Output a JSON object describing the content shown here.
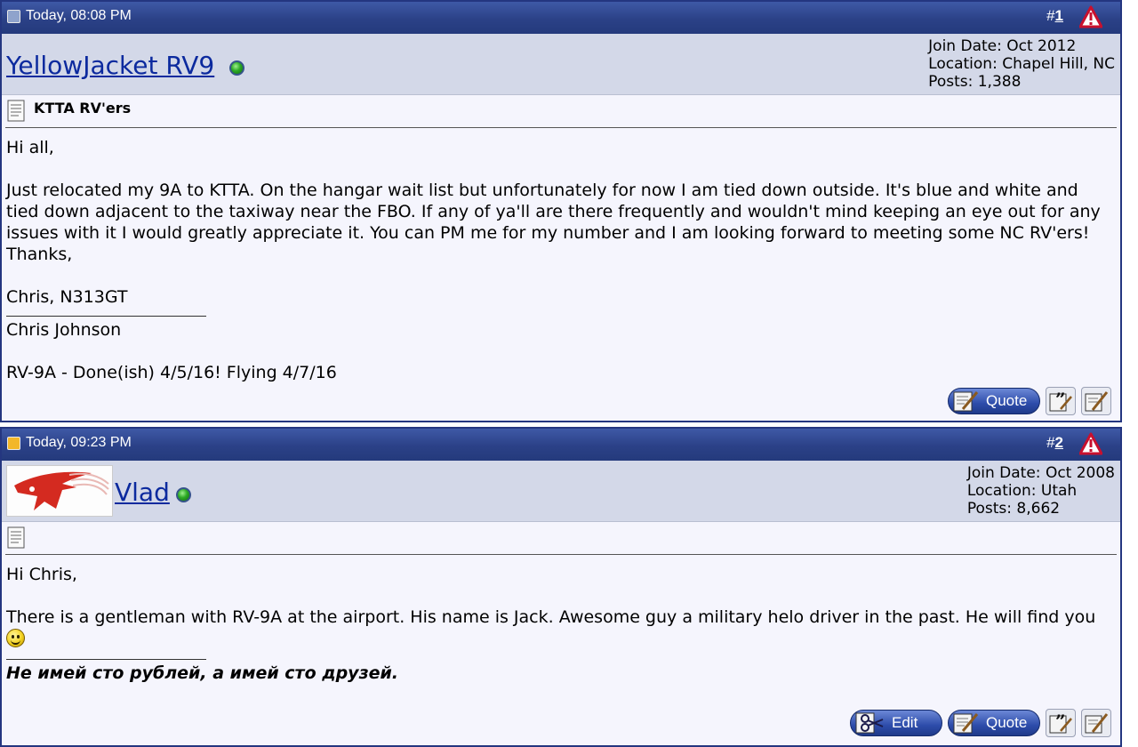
{
  "posts": [
    {
      "date": "Today, 08:08 PM",
      "number_prefix": "#",
      "number": "1",
      "username": "YellowJacket RV9",
      "join_date": "Join Date: Oct 2012",
      "location": "Location: Chapel Hill, NC",
      "posts": "Posts: 1,388",
      "title": "KTTA RV'ers",
      "greeting": "Hi all,",
      "body": "Just relocated my 9A to KTTA. On the hangar wait list but unfortunately for now I am tied down outside. It's blue and white and tied down adjacent to the taxiway near the FBO. If any of ya'll are there frequently and wouldn't mind keeping an eye out for any issues with it I would greatly appreciate it. You can PM me for my number and I am looking forward to meeting some NC RV'ers! Thanks,",
      "signoff": "Chris, N313GT",
      "sig_line1": "Chris Johnson",
      "sig_line2": "RV-9A - Done(ish) 4/5/16! Flying 4/7/16",
      "quote_label": "Quote"
    },
    {
      "date": "Today, 09:23 PM",
      "number_prefix": "#",
      "number": "2",
      "username": "Vlad",
      "join_date": "Join Date: Oct 2008",
      "location": "Location: Utah",
      "posts": "Posts: 8,662",
      "greeting": "Hi Chris,",
      "body": "There is a gentleman with RV-9A at the airport. His name is Jack. Awesome guy a military helo driver in the past. He will find you",
      "signature": "Не имей сто рублей, а имей сто друзей.",
      "edit_label": "Edit",
      "quote_label": "Quote"
    }
  ],
  "icons": {
    "read_post": "post-status-icon",
    "new_post": "post-status-new-icon",
    "report": "warning-triangle-icon",
    "doc": "document-icon",
    "online": "online-status-icon",
    "quote": "quote-pencil-icon",
    "multiquote": "multi-quote-icon",
    "quick_reply": "quick-reply-icon",
    "edit": "edit-scissors-icon",
    "smiley": "smiley-icon"
  },
  "colors": {
    "header_bg": "#2b4187",
    "userrow_bg": "#d3d8e8",
    "post_bg": "#f5f5fd",
    "link": "#0c2a9e",
    "online": "#2caa24"
  }
}
